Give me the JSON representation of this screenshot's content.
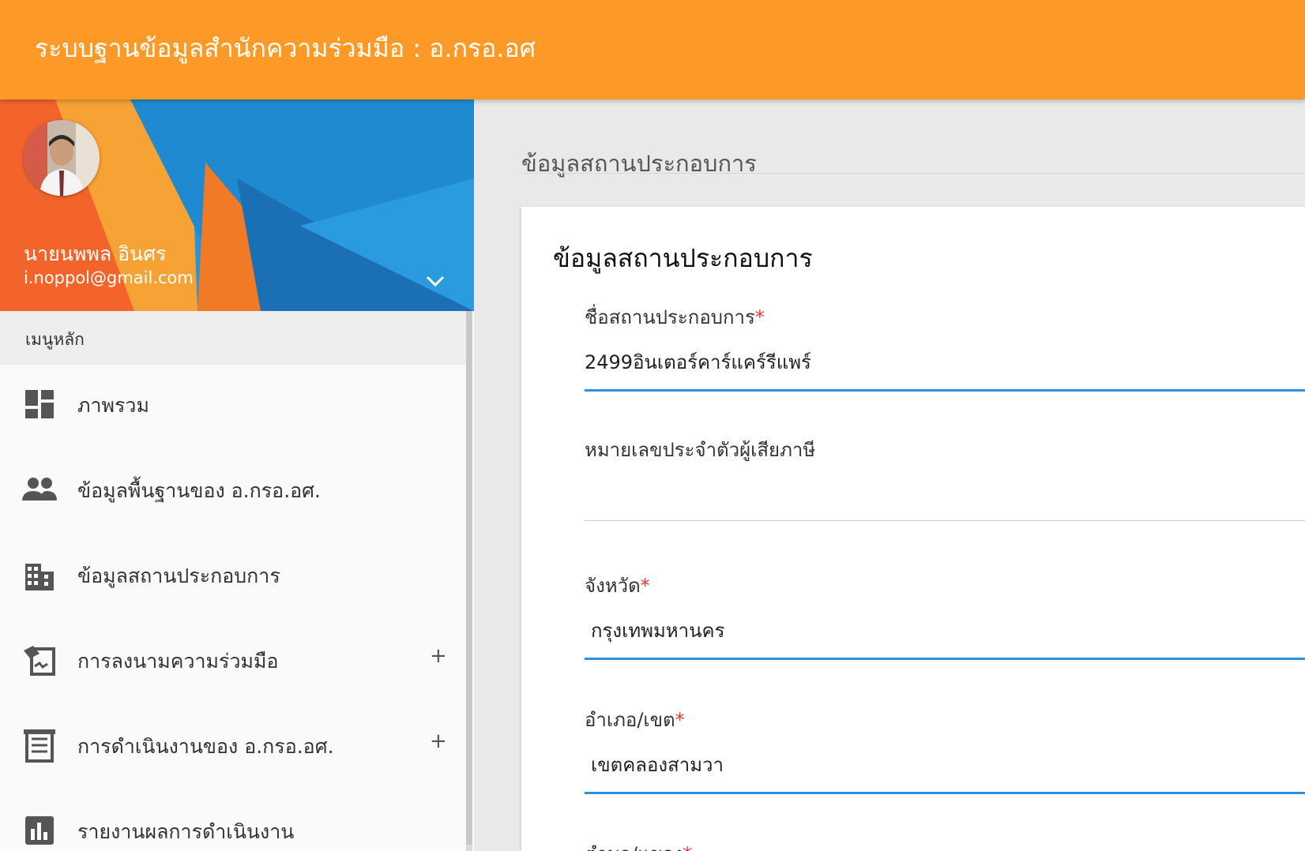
{
  "header": {
    "title": "ระบบฐานข้อมูลสำนักความร่วมมือ : อ.กรอ.อศ"
  },
  "profile": {
    "name": "นายนพพล อินศร",
    "email": "i.noppol@gmail.com",
    "toggle_icon": "chevron-down-icon"
  },
  "sidebar": {
    "header": "เมนูหลัก",
    "items": [
      {
        "label": "ภาพรวม",
        "icon": "dashboard-icon",
        "expandable": false
      },
      {
        "label": "ข้อมูลพื้นฐานของ อ.กรอ.อศ.",
        "icon": "people-icon",
        "expandable": false
      },
      {
        "label": "ข้อมูลสถานประกอบการ",
        "icon": "business-icon",
        "expandable": false
      },
      {
        "label": "การลงนามความร่วมมือ",
        "icon": "signing-icon",
        "expandable": true,
        "expand_symbol": "+"
      },
      {
        "label": "การดำเนินงานของ อ.กรอ.อศ.",
        "icon": "receipt-icon",
        "expandable": true,
        "expand_symbol": "+"
      },
      {
        "label": "รายงานผลการดำเนินงาน",
        "icon": "chart-icon",
        "expandable": false
      }
    ]
  },
  "main": {
    "heading": "ข้อมูลสถานประกอบการ",
    "card": {
      "title": "ข้อมูลสถานประกอบการ",
      "fields": [
        {
          "label": "ชื่อสถานประกอบการ",
          "required": true,
          "required_mark": "*",
          "value": "2499อินเตอร์คาร์แคร์รีแพร์"
        },
        {
          "label": "หมายเลขประจำตัวผู้เสียภาษี",
          "required": false,
          "required_mark": "",
          "value": ""
        },
        {
          "label": "จังหวัด",
          "required": true,
          "required_mark": "*",
          "value": "กรุงเทพมหานคร"
        },
        {
          "label": "อำเภอ/เขต",
          "required": true,
          "required_mark": "*",
          "value": "เขตคลองสามวา"
        },
        {
          "label": "ตำบล/แขวง",
          "required": true,
          "required_mark": "*",
          "value": ""
        }
      ]
    }
  },
  "colors": {
    "header_bg": "#fd9a27",
    "accent_blue": "#2d8fe4",
    "required": "#e53935"
  }
}
